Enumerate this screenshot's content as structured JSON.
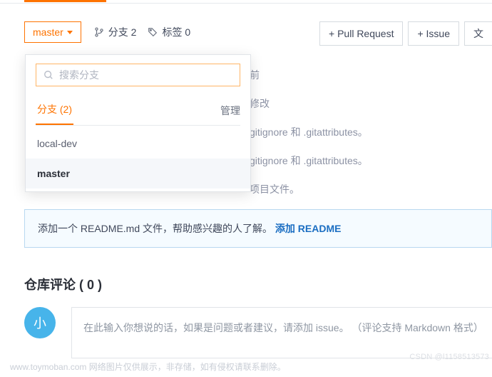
{
  "toolbar": {
    "branch_button": "master",
    "branch_count_label": "分支 2",
    "tag_count_label": "标签 0",
    "pull_request": "+ Pull Request",
    "issue": "+ Issue",
    "more": "文"
  },
  "dropdown": {
    "search_placeholder": "搜索分支",
    "tab_label": "分支 (2)",
    "manage_label": "管理",
    "items": [
      {
        "name": "local-dev",
        "selected": false
      },
      {
        "name": "master",
        "selected": true
      }
    ]
  },
  "background_rows": [
    "前",
    "修改",
    "gitignore 和 .gitattributes。",
    "gitignore 和 .gitattributes。",
    "项目文件。"
  ],
  "readme": {
    "text": "添加一个 README.md 文件，帮助感兴趣的人了解。 ",
    "link": "添加 README"
  },
  "comments": {
    "heading": "仓库评论 ( 0 )",
    "avatar_char": "小",
    "placeholder": "在此输入你想说的话，如果是问题或者建议，请添加 issue。 （评论支持 Markdown 格式）"
  },
  "footer": "www.toymoban.com  网络图片仅供展示，非存储，如有侵权请联系删除。",
  "watermark": "CSDN @l1158513573"
}
